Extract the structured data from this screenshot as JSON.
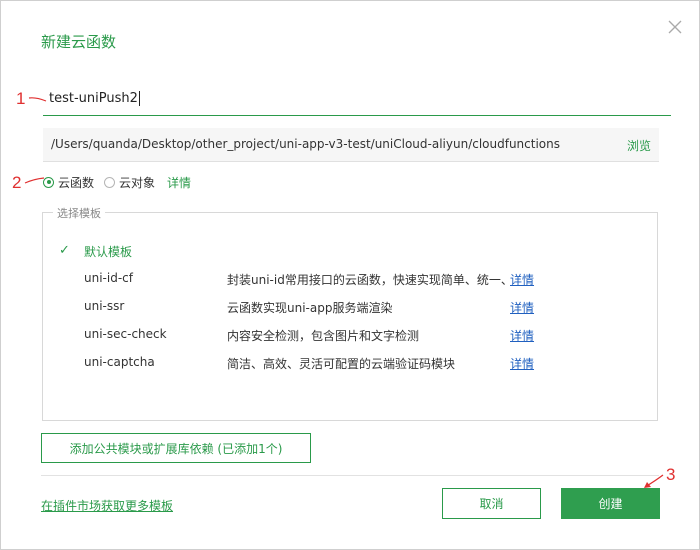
{
  "dialog": {
    "title": "新建云函数",
    "close_icon": "close-icon"
  },
  "annotations": {
    "a1": "1",
    "a2": "2",
    "a3": "3",
    "color": "#e03030"
  },
  "name_input": {
    "value": "test-uniPush2"
  },
  "path": {
    "value": "/Users/quanda/Desktop/other_project/uni-app-v3-test/uniCloud-aliyun/cloudfunctions",
    "browse_label": "浏览"
  },
  "type_select": {
    "option1": "云函数",
    "option2": "云对象",
    "selected": "云函数",
    "detail_label": "详情"
  },
  "templates": {
    "legend": "选择模板",
    "check_icon": "check-icon",
    "items": [
      {
        "name": "默认模板",
        "desc": "",
        "detail": "",
        "selected": true
      },
      {
        "name": "uni-id-cf",
        "desc": "封装uni-id常用接口的云函数，快速实现简单、统一、",
        "detail": "详情"
      },
      {
        "name": "uni-ssr",
        "desc": "云函数实现uni-app服务端渲染",
        "detail": "详情"
      },
      {
        "name": "uni-sec-check",
        "desc": "内容安全检测，包含图片和文字检测",
        "detail": "详情"
      },
      {
        "name": "uni-captcha",
        "desc": "简洁、高效、灵活可配置的云端验证码模块",
        "detail": "详情"
      }
    ]
  },
  "footer": {
    "add_module_label": "添加公共模块或扩展库依赖 (已添加1个)",
    "market_link": "在插件市场获取更多模板",
    "cancel_label": "取消",
    "create_label": "创建"
  },
  "colors": {
    "accent": "#2a9a4a",
    "link_blue": "#2060c0",
    "primary_button": "#2f9e4f"
  }
}
